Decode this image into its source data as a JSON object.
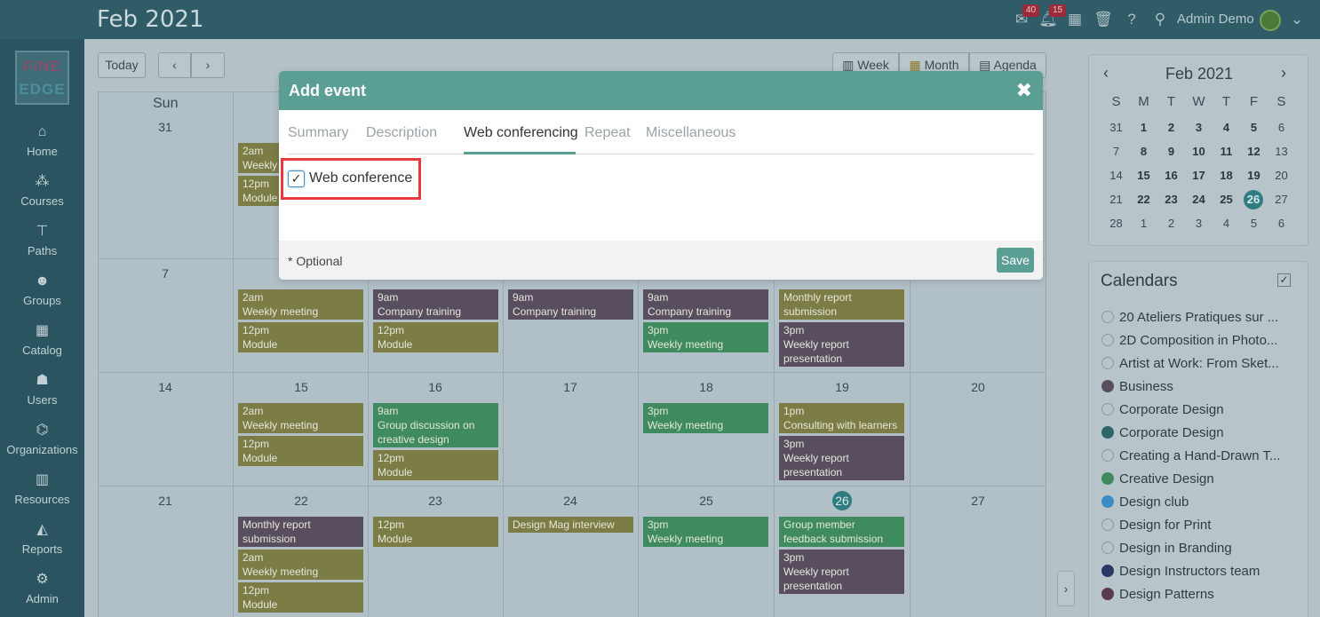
{
  "header": {
    "title": "Feb 2021",
    "messages_badge": "40",
    "notifications_badge": "15",
    "user_name": "Admin Demo"
  },
  "sidebar": {
    "logo_line1": "FINE",
    "logo_line2": "EDGE",
    "items": [
      {
        "label": "Home",
        "icon": "home-icon"
      },
      {
        "label": "Courses",
        "icon": "courses-icon"
      },
      {
        "label": "Paths",
        "icon": "paths-icon"
      },
      {
        "label": "Groups",
        "icon": "groups-icon"
      },
      {
        "label": "Catalog",
        "icon": "catalog-icon"
      },
      {
        "label": "Users",
        "icon": "users-icon"
      },
      {
        "label": "Organizations",
        "icon": "organizations-icon"
      },
      {
        "label": "Resources",
        "icon": "resources-icon"
      },
      {
        "label": "Reports",
        "icon": "reports-icon"
      },
      {
        "label": "Admin",
        "icon": "admin-icon"
      }
    ]
  },
  "toolbar": {
    "today_label": "Today",
    "view_week": "Week",
    "view_month": "Month",
    "view_agenda": "Agenda"
  },
  "calendar": {
    "visible_day_header": "Sun",
    "row_dates": [
      [
        "31",
        "",
        "",
        "",
        "",
        "",
        ""
      ],
      [
        "7",
        "",
        "",
        "",
        "",
        "",
        ""
      ],
      [
        "14",
        "15",
        "16",
        "17",
        "18",
        "19",
        "20"
      ],
      [
        "21",
        "22",
        "23",
        "24",
        "25",
        "26",
        "27"
      ]
    ],
    "today": "26",
    "events": {
      "r1_mon_1_time": "2am",
      "r1_mon_1_title": "Weekly",
      "r1_mon_2_time": "12pm",
      "r1_mon_2_title": "Module",
      "r2_mon_1_time": "2am",
      "r2_mon_1_title": "Weekly meeting",
      "r2_mon_2_time": "12pm",
      "r2_mon_2_title": "Module",
      "r2_tue_1_time": "9am",
      "r2_tue_1_title": "Company training",
      "r2_tue_2_time": "12pm",
      "r2_tue_2_title": "Module",
      "r2_wed_1_time": "9am",
      "r2_wed_1_title": "Company training",
      "r2_thu_1_time": "9am",
      "r2_thu_1_title": "Company training",
      "r2_thu_2_time": "3pm",
      "r2_thu_2_title": "Weekly meeting",
      "r2_fri_1_title": "Monthly report submission",
      "r2_fri_2_time": "3pm",
      "r2_fri_2_title": "Weekly report presentation",
      "r3_mon_1_time": "2am",
      "r3_mon_1_title": "Weekly meeting",
      "r3_mon_2_time": "12pm",
      "r3_mon_2_title": "Module",
      "r3_tue_1_time": "9am",
      "r3_tue_1_title": "Group discussion on creative design",
      "r3_tue_2_time": "12pm",
      "r3_tue_2_title": "Module",
      "r3_thu_1_time": "3pm",
      "r3_thu_1_title": "Weekly meeting",
      "r3_fri_1_time": "1pm",
      "r3_fri_1_title": "Consulting with learners",
      "r3_fri_2_time": "3pm",
      "r3_fri_2_title": "Weekly report presentation",
      "r4_mon_1_title": "Monthly report submission",
      "r4_mon_2_time": "2am",
      "r4_mon_2_title": "Weekly meeting",
      "r4_mon_3_time": "12pm",
      "r4_mon_3_title": "Module",
      "r4_tue_1_time": "12pm",
      "r4_tue_1_title": "Module",
      "r4_wed_1_title": "Design Mag interview",
      "r4_thu_1_time": "3pm",
      "r4_thu_1_title": "Weekly meeting",
      "r4_fri_1_title": "Group member feedback submission",
      "r4_fri_2_time": "3pm",
      "r4_fri_2_title": "Weekly report presentation"
    }
  },
  "mini_calendar": {
    "title": "Feb 2021",
    "weekdays": [
      "S",
      "M",
      "T",
      "W",
      "T",
      "F",
      "S"
    ],
    "weeks": [
      [
        "31",
        "1",
        "2",
        "3",
        "4",
        "5",
        "6"
      ],
      [
        "7",
        "8",
        "9",
        "10",
        "11",
        "12",
        "13"
      ],
      [
        "14",
        "15",
        "16",
        "17",
        "18",
        "19",
        "20"
      ],
      [
        "21",
        "22",
        "23",
        "24",
        "25",
        "26",
        "27"
      ],
      [
        "28",
        "1",
        "2",
        "3",
        "4",
        "5",
        "6"
      ]
    ]
  },
  "calendars_panel": {
    "title": "Calendars",
    "items": [
      {
        "label": "20 Ateliers Pratiques sur ...",
        "color": ""
      },
      {
        "label": "2D Composition in Photo...",
        "color": ""
      },
      {
        "label": "Artist at Work: From Sket...",
        "color": ""
      },
      {
        "label": "Business",
        "color": "#584e5f"
      },
      {
        "label": "Corporate Design",
        "color": ""
      },
      {
        "label": "Corporate Design",
        "color": "#2f6468"
      },
      {
        "label": "Creating a Hand-Drawn T...",
        "color": ""
      },
      {
        "label": "Creative Design",
        "color": "#3f8a5f"
      },
      {
        "label": "Design club",
        "color": "#3c8cc4"
      },
      {
        "label": "Design for Print",
        "color": ""
      },
      {
        "label": "Design in Branding",
        "color": ""
      },
      {
        "label": "Design Instructors team",
        "color": "#2b3766"
      },
      {
        "label": "Design Patterns",
        "color": "#5a3a4c"
      }
    ]
  },
  "modal": {
    "title": "Add event",
    "tabs": [
      "Summary",
      "Description",
      "Web conferencing",
      "Repeat",
      "Miscellaneous"
    ],
    "active_tab": "Web conferencing",
    "web_conference_label": "Web conference",
    "web_conference_checked": true,
    "optional_note": "* Optional",
    "save_label": "Save"
  },
  "colors": {
    "accent": "#5b9e94",
    "highlight": "#e8393f"
  }
}
